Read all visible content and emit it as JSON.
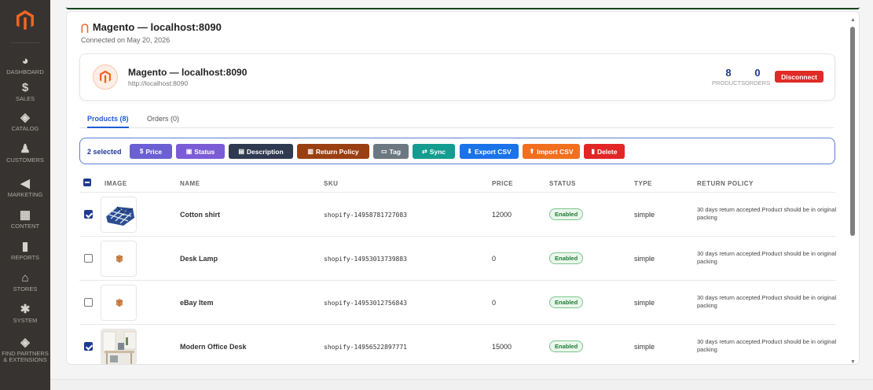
{
  "sidebar": {
    "logo": "magento-logo",
    "items": [
      {
        "label": "DASHBOARD",
        "icon": "dashboard-icon",
        "glyph": "◕"
      },
      {
        "label": "SALES",
        "icon": "dollar-icon",
        "glyph": "$"
      },
      {
        "label": "CATALOG",
        "icon": "cube-icon",
        "glyph": "◈"
      },
      {
        "label": "CUSTOMERS",
        "icon": "person-icon",
        "glyph": "♟"
      },
      {
        "label": "MARKETING",
        "icon": "megaphone-icon",
        "glyph": "◀"
      },
      {
        "label": "CONTENT",
        "icon": "content-icon",
        "glyph": "▦"
      },
      {
        "label": "REPORTS",
        "icon": "bar-chart-icon",
        "glyph": "▮"
      },
      {
        "label": "STORES",
        "icon": "store-icon",
        "glyph": "⌂"
      },
      {
        "label": "SYSTEM",
        "icon": "gear-icon",
        "glyph": "✱"
      },
      {
        "label": "FIND PARTNERS & EXTENSIONS",
        "icon": "extensions-icon",
        "glyph": "◈"
      }
    ]
  },
  "connection": {
    "title": "Magento — localhost:8090",
    "subtitle": "Connected on May 20, 2026"
  },
  "store": {
    "name": "Magento — localhost:8090",
    "url": "http://localhost:8090",
    "products_count": "8",
    "products_label": "PRODUCTS",
    "orders_count": "0",
    "orders_label": "ORDERS",
    "disconnect_label": "Disconnect"
  },
  "tabs": [
    {
      "label": "Products (8)",
      "active": true
    },
    {
      "label": "Orders (0)",
      "active": false
    }
  ],
  "actions": {
    "selected_text": "2 selected",
    "buttons": [
      {
        "label": "Price",
        "glyph": "$",
        "color": "#6b5fd3"
      },
      {
        "label": "Status",
        "glyph": "▣",
        "color": "#7b5cd6"
      },
      {
        "label": "Description",
        "glyph": "▤",
        "color": "#2f3a50"
      },
      {
        "label": "Return Policy",
        "glyph": "▥",
        "color": "#9a3f12"
      },
      {
        "label": "Tag",
        "glyph": "▭",
        "color": "#6c7781"
      },
      {
        "label": "Sync",
        "glyph": "⇄",
        "color": "#139c8f"
      },
      {
        "label": "Export CSV",
        "glyph": "⬇",
        "color": "#1a73e8"
      },
      {
        "label": "Import CSV",
        "glyph": "⬆",
        "color": "#f26f1f"
      },
      {
        "label": "Delete",
        "glyph": "▮",
        "color": "#e22626"
      }
    ]
  },
  "table": {
    "columns": [
      "IMAGE",
      "NAME",
      "SKU",
      "PRICE",
      "STATUS",
      "TYPE",
      "RETURN POLICY"
    ],
    "rows": [
      {
        "checked": true,
        "image": "shirt-image",
        "name": "Cotton shirt",
        "sku": "shopify-14958781727083",
        "price": "12000",
        "status": "Enabled",
        "type": "simple",
        "policy": "30 days return accepted.Product should be in original packing"
      },
      {
        "checked": false,
        "image": "placeholder-box-image",
        "name": "Desk Lamp",
        "sku": "shopify-14953013739883",
        "price": "0",
        "status": "Enabled",
        "type": "simple",
        "policy": "30 days return accepted.Product should be in original packing"
      },
      {
        "checked": false,
        "image": "placeholder-box-image",
        "name": "eBay Item",
        "sku": "shopify-14953012756843",
        "price": "0",
        "status": "Enabled",
        "type": "simple",
        "policy": "30 days return accepted.Product should be in original packing"
      },
      {
        "checked": true,
        "image": "office-desk-image",
        "name": "Modern Office Desk",
        "sku": "shopify-14956522897771",
        "price": "15000",
        "status": "Enabled",
        "type": "simple",
        "policy": "30 days return accepted.Product should be in original packing"
      }
    ]
  },
  "colors": {
    "sidebar_bg": "#373330",
    "accent_blue": "#1f3a93",
    "magento_orange": "#f26322",
    "disconnect_red": "#e02b27",
    "enabled_green": "#1e7a35"
  }
}
